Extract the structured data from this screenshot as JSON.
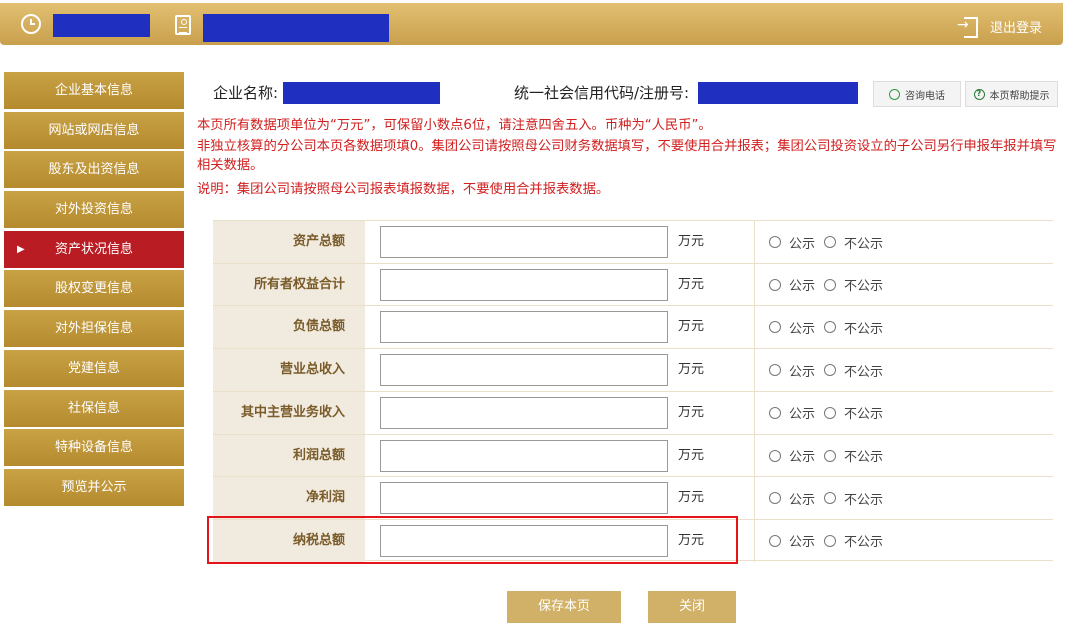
{
  "header": {
    "logout_label": "退出登录"
  },
  "company": {
    "name_label": "企业名称:",
    "code_label": "统一社会信用代码/注册号:"
  },
  "top_buttons": {
    "consult": "咨询电话",
    "help": "本页帮助提示"
  },
  "sidebar": {
    "items": [
      {
        "label": "企业基本信息",
        "active": false
      },
      {
        "label": "网站或网店信息",
        "active": false
      },
      {
        "label": "股东及出资信息",
        "active": false
      },
      {
        "label": "对外投资信息",
        "active": false
      },
      {
        "label": "资产状况信息",
        "active": true
      },
      {
        "label": "股权变更信息",
        "active": false
      },
      {
        "label": "对外担保信息",
        "active": false
      },
      {
        "label": "党建信息",
        "active": false
      },
      {
        "label": "社保信息",
        "active": false
      },
      {
        "label": "特种设备信息",
        "active": false
      },
      {
        "label": "预览并公示",
        "active": false
      }
    ]
  },
  "notices": {
    "line1": "本页所有数据项单位为“万元”，可保留小数点6位，请注意四舍五入。币种为“人民币”。",
    "line2": "非独立核算的分公司本页各数据项填0。集团公司请按照母公司财务数据填写，不要使用合并报表；集团公司投资设立的子公司另行申报年报并填写相关数据。",
    "line3": "说明：集团公司请按照母公司报表填报数据，不要使用合并报表数据。"
  },
  "form": {
    "unit": "万元",
    "option_public": "公示",
    "option_private": "不公示",
    "rows": [
      {
        "label": "资产总额",
        "value": ""
      },
      {
        "label": "所有者权益合计",
        "value": ""
      },
      {
        "label": "负债总额",
        "value": ""
      },
      {
        "label": "营业总收入",
        "value": ""
      },
      {
        "label": "其中主营业务收入",
        "value": ""
      },
      {
        "label": "利润总额",
        "value": ""
      },
      {
        "label": "净利润",
        "value": ""
      },
      {
        "label": "纳税总额",
        "value": ""
      }
    ]
  },
  "actions": {
    "save": "保存本页",
    "close": "关闭"
  },
  "colors": {
    "gold": "#c9a246",
    "active_red": "#b91c22",
    "notice_red": "#d12020",
    "highlight_red": "#e5141b",
    "redaction_blue": "#1f2fbf"
  }
}
